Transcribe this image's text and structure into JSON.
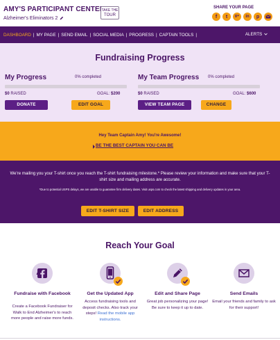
{
  "header": {
    "title": "AMY'S PARTICIPANT CENTER",
    "team": "Alzheimer's Eliminators 2",
    "tour_line1": "TAKE THE",
    "tour_line2": "TOUR",
    "share_label": "SHARE YOUR PAGE",
    "social_icons": [
      "facebook-icon",
      "twitter-icon",
      "google-plus-icon",
      "linkedin-icon",
      "pinterest-icon",
      "email-icon"
    ]
  },
  "nav": {
    "items": [
      "DASHBOARD",
      "MY PAGE",
      "SEND EMAIL",
      "SOCIAL MEDIA",
      "PROGRESS",
      "CAPTAIN TOOLS"
    ],
    "alerts": "ALERTS"
  },
  "progress": {
    "title": "Fundraising Progress",
    "mine": {
      "heading": "My Progress",
      "percent_label": "0% completed",
      "percent": 0,
      "raised_amount": "$0",
      "raised_label": "RAISED",
      "goal_label": "GOAL:",
      "goal_amount": "$200",
      "primary_button": "DONATE",
      "secondary_button": "EDIT GOAL"
    },
    "team": {
      "heading": "My Team Progress",
      "percent_label": "0% completed",
      "percent": 0,
      "raised_amount": "$0",
      "raised_label": "RAISED",
      "goal_label": "GOAL:",
      "goal_amount": "$600",
      "primary_button": "VIEW TEAM PAGE",
      "secondary_button": "CHANGE"
    }
  },
  "captain": {
    "message": "Hey Team Captain Amy! You're Awesome!",
    "link": "BE THE BEST CAPTAIN YOU CAN BE"
  },
  "shirt": {
    "text": "We're mailing you your T-shirt once you reach the T-shirt fundraising milestone.* Please review your information and make sure that your T-shirt size and mailing address are accurate.",
    "note": "*Due to potential USPS delays, we are unable to guarantee firm delivery dates. Visit usps.com to check the latest shipping and delivery updates in your area.",
    "size_button": "EDIT T-SHIRT SIZE",
    "address_button": "EDIT ADDRESS"
  },
  "reach": {
    "title": "Reach Your Goal",
    "cards": [
      {
        "icon": "facebook-icon",
        "title": "Fundraise with Facebook",
        "text": "Create a Facebook Fundraiser for Walk to End Alzheimer's to reach more people and raise more funds."
      },
      {
        "icon": "mobile-app-icon",
        "title": "Get the Updated App",
        "text": "Access fundraising tools and deposit checks. Also track your steps!",
        "link": "Read the mobile app instructions."
      },
      {
        "icon": "pencil-icon",
        "title": "Edit and Share Page",
        "text": "Great job personalizing your page! Be sure to keep it up to date."
      },
      {
        "icon": "envelope-icon",
        "title": "Send Emails",
        "text": "Email your friends and family to ask for their support!"
      }
    ]
  },
  "colors": {
    "purple": "#4d1669",
    "orange": "#f7a81b",
    "lavender": "#f0e3f6"
  }
}
